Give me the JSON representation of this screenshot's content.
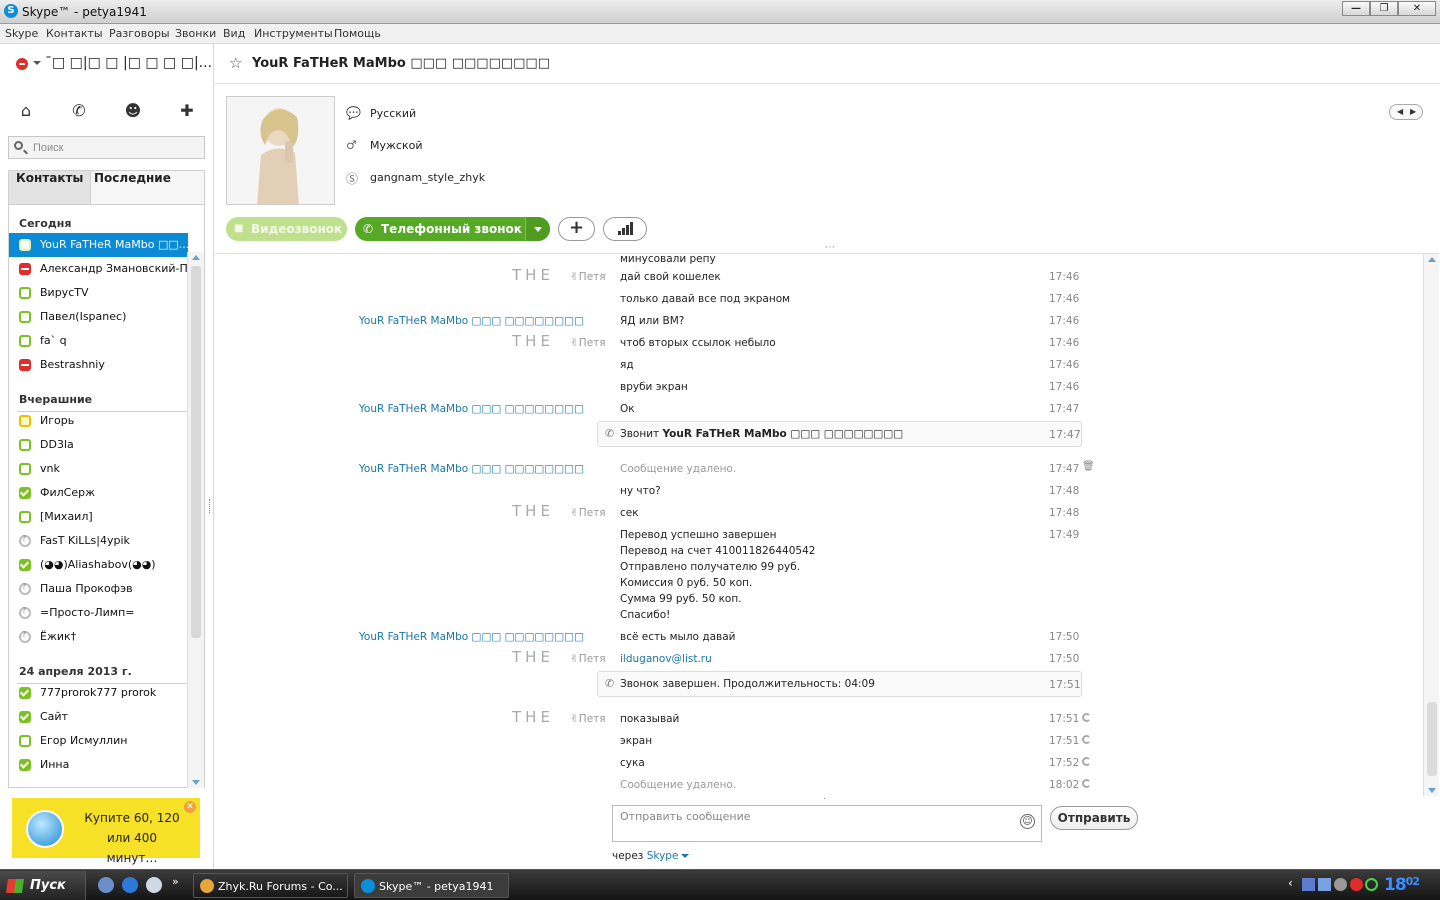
{
  "window": {
    "title": "Skype™ - petya1941",
    "minimize": "—",
    "maximize": "❐",
    "close": "✕"
  },
  "menu": [
    "Skype",
    "Контакты",
    "Разговоры",
    "Звонки",
    "Вид",
    "Инструменты",
    "Помощь"
  ],
  "user": {
    "name": "¯□ □|□ □ |□ □ □ □|..."
  },
  "search": {
    "placeholder": "Поиск"
  },
  "tabs": {
    "contacts": "Контакты",
    "recent": "Последние"
  },
  "groups": {
    "today": "Сегодня",
    "yesterday": "Вчерашние",
    "date": "24 апреля 2013 г."
  },
  "contacts": [
    {
      "name": "YouR FaTHeR MaMbo □□...",
      "status": "online"
    },
    {
      "name": "Александр Змановский-П...",
      "status": "busy"
    },
    {
      "name": "ВирусTV",
      "status": "online"
    },
    {
      "name": "Павел(Ispanec)",
      "status": "online"
    },
    {
      "name": "fa` q",
      "status": "online"
    },
    {
      "name": "Bestrashniy",
      "status": "busy"
    },
    {
      "name": "Игорь",
      "status": "away"
    },
    {
      "name": "DD3la",
      "status": "online"
    },
    {
      "name": "vnk",
      "status": "online"
    },
    {
      "name": "ФилСерж",
      "status": "online-ok"
    },
    {
      "name": "[Михаил]",
      "status": "online"
    },
    {
      "name": "FasT KiLLs|4ypik",
      "status": "unknown"
    },
    {
      "name": "(◕◕)Aliashabov(◕◕)",
      "status": "online-ok"
    },
    {
      "name": "Паша Прокофэв",
      "status": "unknown"
    },
    {
      "name": "=Просто-Лимп=",
      "status": "unknown"
    },
    {
      "name": "Ёжик†",
      "status": "unknown"
    },
    {
      "name": "777prorok777 prorok",
      "status": "online-ok"
    },
    {
      "name": "Сайт",
      "status": "online-ok"
    },
    {
      "name": "Егор Исмуллин",
      "status": "online"
    },
    {
      "name": "Инна",
      "status": "online-ok"
    }
  ],
  "ad": {
    "text": "Купите 60, 120 или 400 минут…"
  },
  "conversation": {
    "title": "YouR FaTHeR MaMbo □□□ □□□□□□□□",
    "profile": {
      "language": "Русский",
      "gender": "Мужской",
      "skype": "gangnam_style_zhyk"
    },
    "buttons": {
      "video": "Видеозвонок",
      "call": "Телефонный звонок"
    }
  },
  "messages": [
    {
      "sender": "",
      "body": "минусовали репу",
      "time": ""
    },
    {
      "sender": "me",
      "body": "дай свой кошелек",
      "time": "17:46"
    },
    {
      "sender": "",
      "body": "только давай все под экраном",
      "time": "17:46"
    },
    {
      "sender": "YouR FaTHeR MaMbo □□□ □□□□□□□□",
      "body": "ЯД или ВМ?",
      "time": "17:46"
    },
    {
      "sender": "me",
      "body": "чтоб вторых ссылок небыло",
      "time": "17:46"
    },
    {
      "sender": "",
      "body": "яд",
      "time": "17:46"
    },
    {
      "sender": "",
      "body": "вруби экран",
      "time": "17:46"
    },
    {
      "sender": "YouR FaTHeR MaMbo □□□ □□□□□□□□",
      "body": "Ок",
      "time": "17:47"
    },
    {
      "call": true,
      "prefix": "Звонит",
      "bold": "YouR FaTHeR MaMbo □□□ □□□□□□□□",
      "time": "17:47"
    },
    {
      "sender": "YouR FaTHeR MaMbo □□□ □□□□□□□□",
      "body": "Сообщение удалено.",
      "time": "17:47",
      "deleted": true
    },
    {
      "sender": "",
      "body": "ну что?",
      "time": "17:48"
    },
    {
      "sender": "me",
      "body": "сек",
      "time": "17:48"
    },
    {
      "sender": "",
      "body": "Перевод успешно завершен",
      "time": "17:49"
    },
    {
      "sender": "",
      "body": "Перевод на счет 410011826440542",
      "time": ""
    },
    {
      "sender": "",
      "body": "Отправлено получателю 99 руб.",
      "time": ""
    },
    {
      "sender": "",
      "body": "Комиссия 0 руб. 50 коп.",
      "time": ""
    },
    {
      "sender": "",
      "body": "Сумма 99 руб. 50 коп.",
      "time": ""
    },
    {
      "sender": "",
      "body": "Спасибо!",
      "time": ""
    },
    {
      "sender": "YouR FaTHeR MaMbo □□□ □□□□□□□□",
      "body": "всё есть мыло давай",
      "time": "17:50"
    },
    {
      "sender": "me",
      "body": "ilduganov@list.ru",
      "time": "17:50",
      "link": true
    },
    {
      "call": true,
      "prefix": "Звонок завершен. Продолжительность: 04:09",
      "bold": "",
      "time": "17:51"
    },
    {
      "sender": "me",
      "body": "показывай",
      "time": "17:51",
      "pending": true
    },
    {
      "sender": "",
      "body": "экран",
      "time": "17:51",
      "pending": true
    },
    {
      "sender": "",
      "body": "сука",
      "time": "17:52",
      "pending": true
    },
    {
      "sender": "",
      "body": "Сообщение удалено.",
      "time": "18:02",
      "pending": true,
      "deleted": true
    }
  ],
  "me_label": {
    "logo": "THE",
    "name": "✌Петя"
  },
  "compose": {
    "placeholder": "Отправить сообщение",
    "send": "Отправить",
    "via_prefix": "через",
    "via": "Skype"
  },
  "taskbar": {
    "start": "Пуск",
    "items": [
      {
        "label": "Zhyk.Ru Forums - Co..."
      },
      {
        "label": "Skype™ - petya1941"
      }
    ],
    "clock_h": "18",
    "clock_m": "02"
  },
  "colors": {
    "accent": "#0b8bd6",
    "green": "#56a925",
    "link": "#1b77a8"
  }
}
